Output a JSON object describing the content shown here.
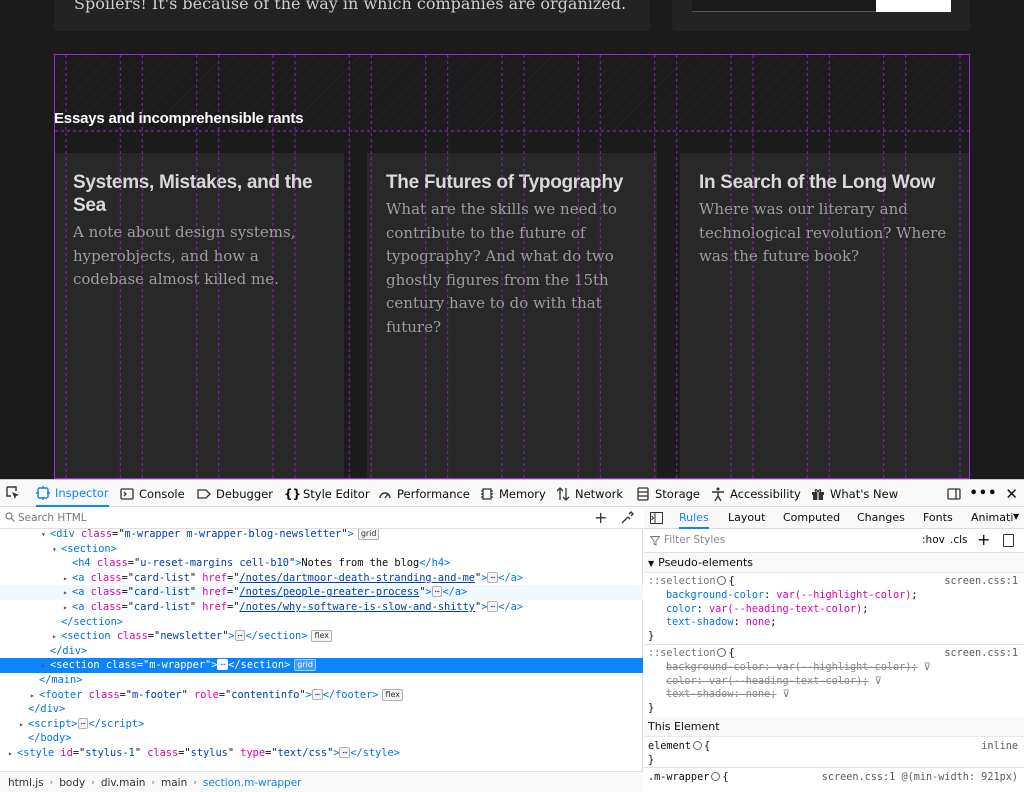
{
  "page": {
    "top_card_text": "Spoilers! It's because of the way in which companies are organized.",
    "section_heading": "Essays and incomprehensible rants",
    "colors": {
      "background": "#1b1b1b",
      "card": "#2a2a2a",
      "grid_overlay": "#9b2bd6"
    },
    "cards": [
      {
        "title": "Systems, Mistakes, and the Sea",
        "description": "A note about design systems, hyperobjects, and how a codebase almost killed me."
      },
      {
        "title": "The Futures of Typography",
        "description": "What are the skills we need to contribute to the future of typography? And what do two ghostly figures from the 15th century have to do with that future?"
      },
      {
        "title": "In Search of the Long Wow",
        "description": "Where was our literary and technological revolution? Where was the future book?"
      }
    ]
  },
  "devtools": {
    "tabs": [
      "Inspector",
      "Console",
      "Debugger",
      "Style Editor",
      "Performance",
      "Memory",
      "Network",
      "Storage",
      "Accessibility",
      "What's New"
    ],
    "active_tab": "Inspector",
    "search_placeholder": "Search HTML",
    "markup": [
      {
        "indent": 3,
        "tw": "▾",
        "tag": "div",
        "attrs": [
          [
            "class",
            "m-wrapper m-wrapper-blog-newsletter"
          ]
        ],
        "badge": "grid",
        "close": false
      },
      {
        "indent": 4,
        "tw": "▾",
        "tag": "section",
        "attrs": [],
        "close": false
      },
      {
        "indent": 5,
        "tw": "",
        "tag": "h4",
        "attrs": [
          [
            "class",
            "u-reset-margins cell-b10"
          ]
        ],
        "text": "Notes from the blog",
        "close": true
      },
      {
        "indent": 5,
        "tw": "▸",
        "tag": "a",
        "attrs": [
          [
            "class",
            "card-list"
          ],
          [
            "href",
            "/notes/dartmoor-death-stranding-and-me"
          ]
        ],
        "dots": true,
        "close": true
      },
      {
        "indent": 5,
        "tw": "▸",
        "tag": "a",
        "attrs": [
          [
            "class",
            "card-list"
          ],
          [
            "href",
            "/notes/people-greater-process"
          ]
        ],
        "dots": true,
        "close": true,
        "hover": true
      },
      {
        "indent": 5,
        "tw": "▸",
        "tag": "a",
        "attrs": [
          [
            "class",
            "card-list"
          ],
          [
            "href",
            "/notes/why-software-is-slow-and-shitty"
          ]
        ],
        "dots": true,
        "close": true
      },
      {
        "indent": 4,
        "tw": "",
        "closing": "section"
      },
      {
        "indent": 4,
        "tw": "▸",
        "tag": "section",
        "attrs": [
          [
            "class",
            "newsletter"
          ]
        ],
        "dots": true,
        "close": true,
        "badge": "flex"
      },
      {
        "indent": 3,
        "tw": "",
        "closing": "div"
      },
      {
        "indent": 3,
        "tw": "▸",
        "tag": "section",
        "attrs": [
          [
            "class",
            "m-wrapper"
          ]
        ],
        "dots": true,
        "close": true,
        "badge": "grid",
        "selected": true
      },
      {
        "indent": 2,
        "tw": "",
        "closing": "main"
      },
      {
        "indent": 2,
        "tw": "▸",
        "tag": "footer",
        "attrs": [
          [
            "class",
            "m-footer"
          ],
          [
            "role",
            "contentinfo"
          ]
        ],
        "dots": true,
        "close": true,
        "badge": "flex"
      },
      {
        "indent": 1,
        "tw": "",
        "closing": "div"
      },
      {
        "indent": 1,
        "tw": "▸",
        "tag": "script",
        "attrs": [],
        "dots": true,
        "close": true
      },
      {
        "indent": 1,
        "tw": "",
        "closing": "body"
      },
      {
        "indent": 0,
        "tw": "▸",
        "tag": "style",
        "attrs": [
          [
            "id",
            "stylus-1"
          ],
          [
            "class",
            "stylus"
          ],
          [
            "type",
            "text/css"
          ]
        ],
        "dots": true,
        "close": true
      }
    ],
    "breadcrumbs": [
      "html.js",
      "body",
      "div.main",
      "main",
      "section.m-wrapper"
    ],
    "rules_tabs": [
      "Rules",
      "Layout",
      "Computed",
      "Changes",
      "Fonts",
      "Animati"
    ],
    "active_rules_tab": "Rules",
    "filter_placeholder": "Filter Styles",
    "hov_label": ":hov",
    "cls_label": ".cls",
    "pseudo_header": "Pseudo-elements",
    "this_element_header": "This Element",
    "rule1": {
      "selector": "::selection",
      "source": "screen.css:1",
      "decls": [
        [
          "background-color",
          "var(--highlight-color)"
        ],
        [
          "color",
          "var(--heading-text-color)"
        ],
        [
          "text-shadow",
          "none"
        ]
      ]
    },
    "rule2": {
      "selector": "::selection",
      "source": "screen.css:1",
      "decls": [
        [
          "background-color",
          "var(--highlight-color)"
        ],
        [
          "color",
          "var(--heading-text-color)"
        ],
        [
          "text-shadow",
          "none"
        ]
      ]
    },
    "element_rule": {
      "selector": "element",
      "source": "inline"
    },
    "wrapper_rule": {
      "selector": ".m-wrapper",
      "source": "screen.css:1 @(min-width: 921px)"
    }
  }
}
